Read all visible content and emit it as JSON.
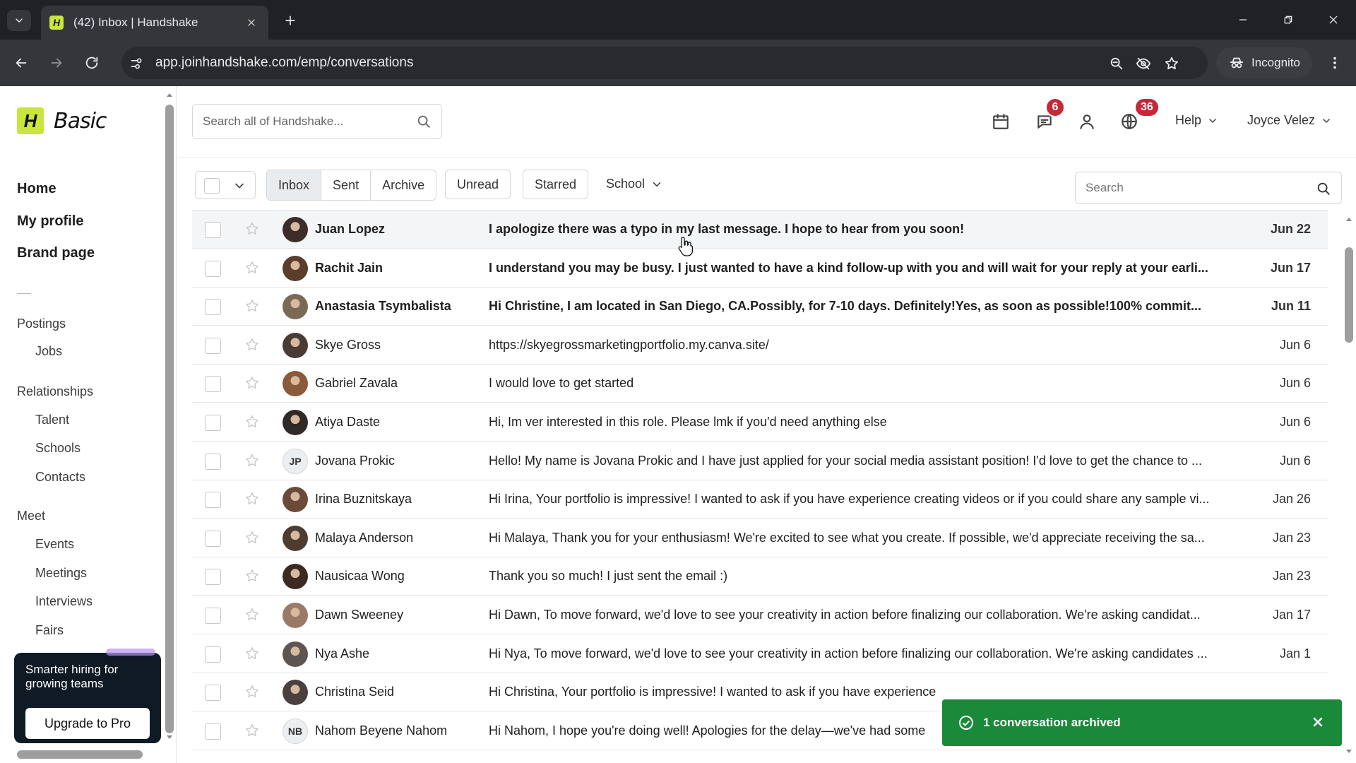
{
  "browser": {
    "tab_title": "(42) Inbox | Handshake",
    "favicon_letter": "H",
    "url": "app.joinhandshake.com/emp/conversations",
    "incognito_label": "Incognito"
  },
  "sidebar": {
    "brand_letter": "H",
    "brand_plan": "Basic",
    "main": [
      {
        "label": "Home"
      },
      {
        "label": "My profile"
      },
      {
        "label": "Brand page"
      }
    ],
    "sections": [
      {
        "title": "Postings",
        "items": [
          "Jobs"
        ]
      },
      {
        "title": "Relationships",
        "items": [
          "Talent",
          "Schools",
          "Contacts"
        ]
      },
      {
        "title": "Meet",
        "items": [
          "Events",
          "Meetings",
          "Interviews",
          "Fairs"
        ]
      }
    ],
    "promo": {
      "text": "Smarter hiring for growing teams",
      "button": "Upgrade to Pro"
    }
  },
  "header": {
    "search_placeholder": "Search all of Handshake...",
    "messages_badge": "6",
    "notifications_badge": "36",
    "help_label": "Help",
    "user_name": "Joyce Velez"
  },
  "filters": {
    "tabs": [
      {
        "label": "Inbox",
        "active": true
      },
      {
        "label": "Sent",
        "active": false
      },
      {
        "label": "Archive",
        "active": false
      }
    ],
    "unread_label": "Unread",
    "starred_label": "Starred",
    "school_label": "School",
    "search_placeholder": "Search"
  },
  "conversations": [
    {
      "name": "Juan Lopez",
      "message": "I apologize there was a typo in my last message. I hope to hear from you soon!",
      "date": "Jun 22",
      "unread": true,
      "avatar": "photo",
      "avatar_color": "#3b2e2a"
    },
    {
      "name": "Rachit Jain",
      "message": "I understand you may be busy. I just wanted to have a kind follow-up with you and will wait for your reply at your earli...",
      "date": "Jun 17",
      "unread": true,
      "avatar": "photo",
      "avatar_color": "#5a3d2b"
    },
    {
      "name": "Anastasia Tsymbalista",
      "message": "Hi Christine, I am located in San Diego, CA.Possibly, for 7-10 days. Definitely!Yes, as soon as possible!100% commit...",
      "date": "Jun 11",
      "unread": true,
      "avatar": "photo",
      "avatar_color": "#7a6a55"
    },
    {
      "name": "Skye Gross",
      "message": "https://skyegrossmarketingportfolio.my.canva.site/",
      "date": "Jun 6",
      "unread": false,
      "avatar": "photo",
      "avatar_color": "#4a3b36"
    },
    {
      "name": "Gabriel Zavala",
      "message": "I would love to get started",
      "date": "Jun 6",
      "unread": false,
      "avatar": "photo",
      "avatar_color": "#8a5a3a"
    },
    {
      "name": "Atiya Daste",
      "message": "Hi, Im ver interested in this role. Please lmk if you'd need anything else",
      "date": "Jun 6",
      "unread": false,
      "avatar": "photo",
      "avatar_color": "#2f2a28"
    },
    {
      "name": "Jovana Prokic",
      "message": "Hello! My name is Jovana Prokic and I have just applied for your social media assistant position! I'd love to get the chance to ...",
      "date": "Jun 6",
      "unread": false,
      "avatar": "initials",
      "initials": "JP"
    },
    {
      "name": "Irina Buznitskaya",
      "message": "Hi Irina, Your portfolio is impressive! I wanted to ask if you have experience creating videos or if you could share any sample vi...",
      "date": "Jan 26",
      "unread": false,
      "avatar": "photo",
      "avatar_color": "#6b4a3a"
    },
    {
      "name": "Malaya Anderson",
      "message": "Hi Malaya, Thank you for your enthusiasm! We're excited to see what you create. If possible, we'd appreciate receiving the sa...",
      "date": "Jan 23",
      "unread": false,
      "avatar": "photo",
      "avatar_color": "#4d3d30"
    },
    {
      "name": "Nausicaa Wong",
      "message": "Thank you so much! I just sent the email :)",
      "date": "Jan 23",
      "unread": false,
      "avatar": "photo",
      "avatar_color": "#3a2a22"
    },
    {
      "name": "Dawn Sweeney",
      "message": "Hi Dawn,  To move forward, we'd love to see your creativity in action before finalizing our collaboration. We're asking candidat...",
      "date": "Jan 17",
      "unread": false,
      "avatar": "photo",
      "avatar_color": "#9a7a66"
    },
    {
      "name": "Nya Ashe",
      "message": "Hi Nya, To move forward, we'd love to see your creativity in action before finalizing our collaboration. We're asking candidates ...",
      "date": "Jan 1",
      "unread": false,
      "avatar": "photo",
      "avatar_color": "#5c5552"
    },
    {
      "name": "Christina Seid",
      "message": "Hi Christina, Your portfolio is impressive! I wanted to ask if you have experience",
      "date": "",
      "unread": false,
      "avatar": "photo",
      "avatar_color": "#4a4040"
    },
    {
      "name": "Nahom Beyene Nahom",
      "message": "Hi Nahom, I hope you're doing well! Apologies for the delay—we've had some",
      "date": "",
      "unread": false,
      "avatar": "initials",
      "initials": "NB"
    }
  ],
  "toast": {
    "message": "1 conversation archived",
    "color": "#1a8a3a"
  },
  "colors": {
    "brand": "#c8e63d",
    "badge": "#c62839"
  }
}
